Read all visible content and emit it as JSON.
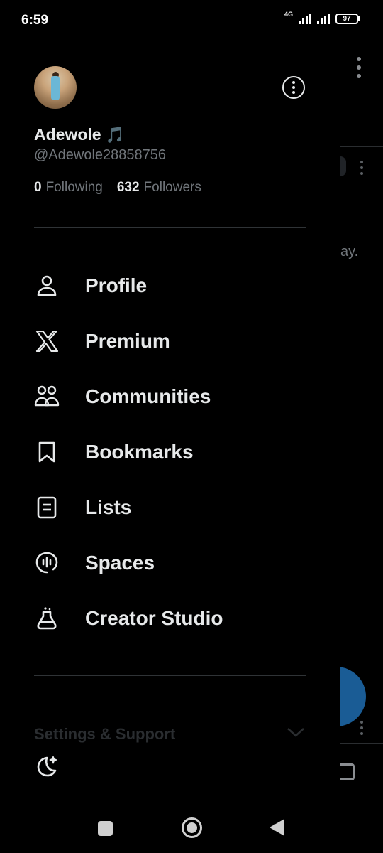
{
  "status_bar": {
    "time": "6:59",
    "network": "4G",
    "battery": "97"
  },
  "background": {
    "partial_text": "ay."
  },
  "profile": {
    "display_name": "Adewole",
    "name_emoji": "🎵",
    "handle": "@Adewole28858756",
    "following_count": "0",
    "following_label": "Following",
    "followers_count": "632",
    "followers_label": "Followers"
  },
  "menu": {
    "items": [
      {
        "label": "Profile",
        "icon": "person-icon"
      },
      {
        "label": "Premium",
        "icon": "x-logo-icon"
      },
      {
        "label": "Communities",
        "icon": "communities-icon"
      },
      {
        "label": "Bookmarks",
        "icon": "bookmark-icon"
      },
      {
        "label": "Lists",
        "icon": "list-icon"
      },
      {
        "label": "Spaces",
        "icon": "spaces-icon"
      },
      {
        "label": "Creator Studio",
        "icon": "flask-icon"
      }
    ]
  },
  "footer": {
    "settings_label": "Settings & Support"
  },
  "colors": {
    "background": "#000000",
    "text_primary": "#e7e9ea",
    "text_secondary": "#71767b",
    "divider": "#2f3336",
    "fab": "#1a5c95"
  }
}
